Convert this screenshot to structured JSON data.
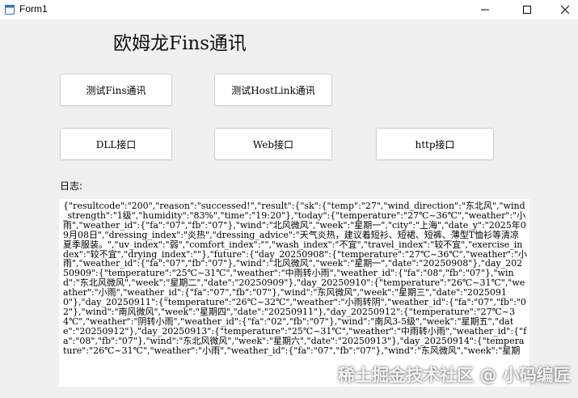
{
  "window": {
    "title": "Form1",
    "minimize_icon": "minimize-icon",
    "maximize_icon": "maximize-icon",
    "close_icon": "close-icon"
  },
  "heading": "欧姆龙Fins通讯",
  "buttons": {
    "fins": "测试Fins通讯",
    "hostlink": "测试HostLink通讯",
    "dll": "DLL接口",
    "web": "Web接口",
    "http": "http接口"
  },
  "log": {
    "label": "日志:",
    "text": "{\"resultcode\":\"200\",\"reason\":\"successed!\",\"result\":{\"sk\":{\"temp\":\"27\",\"wind_direction\":\"东北风\",\"wind_strength\":\"1级\",\"humidity\":\"83%\",\"time\":\"19:20\"},\"today\":{\"temperature\":\"27℃~36℃\",\"weather\":\"小雨\",\"weather_id\":{\"fa\":\"07\",\"fb\":\"07\"},\"wind\":\"北风微风\",\"week\":\"星期一\",\"city\":\"上海\",\"date_y\":\"2025年09月08日\",\"dressing_index\":\"炎热\",\"dressing_advice\":\"天气炎热，建议着短衫、短裙、短裤、薄型T恤衫等清凉夏季服装。\",\"uv_index\":\"弱\",\"comfort_index\":\"\",\"wash_index\":\"不宜\",\"travel_index\":\"较不宜\",\"exercise_index\":\"较不宜\",\"drying_index\":\"\"},\"future\":{\"day_20250908\":{\"temperature\":\"27℃~36℃\",\"weather\":\"小雨\",\"weather_id\":{\"fa\":\"07\",\"fb\":\"07\"},\"wind\":\"北风微风\",\"week\":\"星期一\",\"date\":\"20250908\"},\"day_20250909\":{\"temperature\":\"25℃~31℃\",\"weather\":\"中雨转小雨\",\"weather_id\":{\"fa\":\"08\",\"fb\":\"07\"},\"wind\":\"东北风微风\",\"week\":\"星期二\",\"date\":\"20250909\"},\"day_20250910\":{\"temperature\":\"26℃~31℃\",\"weather\":\"小雨\",\"weather_id\":{\"fa\":\"07\",\"fb\":\"07\"},\"wind\":\"东风微风\",\"week\":\"星期三\",\"date\":\"20250910\"},\"day_20250911\":{\"temperature\":\"26℃~32℃\",\"weather\":\"小雨转阴\",\"weather_id\":{\"fa\":\"07\",\"fb\":\"02\"},\"wind\":\"南风微风\",\"week\":\"星期四\",\"date\":\"20250911\"},\"day_20250912\":{\"temperature\":\"27℃~34℃\",\"weather\":\"阴转小雨\",\"weather_id\":{\"fa\":\"02\",\"fb\":\"07\"},\"wind\":\"南风3-5级\",\"week\":\"星期五\",\"date\":\"20250912\"},\"day_20250913\":{\"temperature\":\"25℃~31℃\",\"weather\":\"中雨转小雨\",\"weather_id\":{\"fa\":\"08\",\"fb\":\"07\"},\"wind\":\"东北风微风\",\"week\":\"星期六\",\"date\":\"20250913\"},\"day_20250914\":{\"temperature\":\"26℃~31℃\",\"weather\":\"小雨\",\"weather_id\":{\"fa\":\"07\",\"fb\":\"07\"},\"wind\":\"东风微风\",\"week\":\"星期"
  },
  "watermark": "稀土掘金技术社区 @ 小码编匠"
}
